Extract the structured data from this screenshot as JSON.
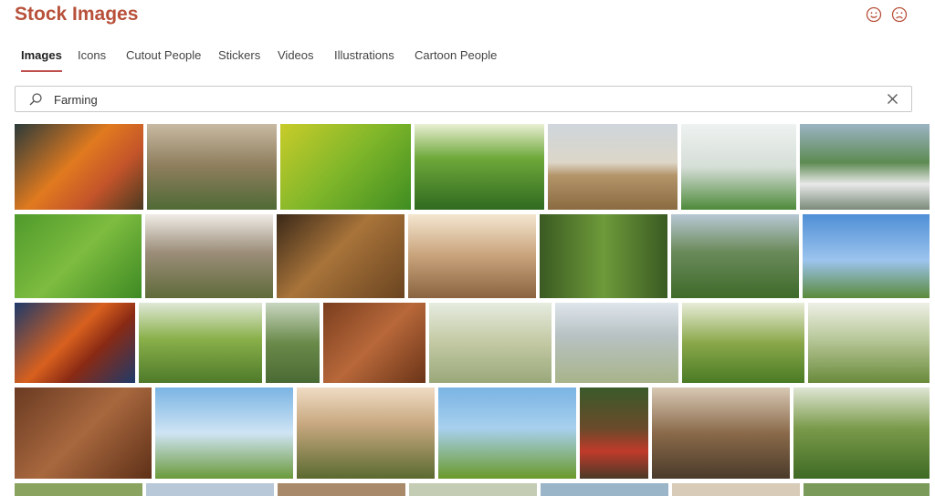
{
  "header": {
    "title": "Stock Images",
    "feedback_icons": [
      "happy-face-icon",
      "sad-face-icon"
    ]
  },
  "tabs": [
    {
      "label": "Images",
      "active": true
    },
    {
      "label": "Icons",
      "active": false
    },
    {
      "label": "Cutout People",
      "active": false
    },
    {
      "label": "Stickers",
      "active": false
    },
    {
      "label": "Videos",
      "active": false
    },
    {
      "label": "Illustrations",
      "active": false
    },
    {
      "label": "Cartoon People",
      "active": false
    }
  ],
  "search": {
    "value": "Farming",
    "icons": [
      "search-icon",
      "clear-icon"
    ]
  },
  "colors": {
    "accent": "#b8503a",
    "tab_underline": "#c0504d",
    "border": "#c8c8c8"
  }
}
